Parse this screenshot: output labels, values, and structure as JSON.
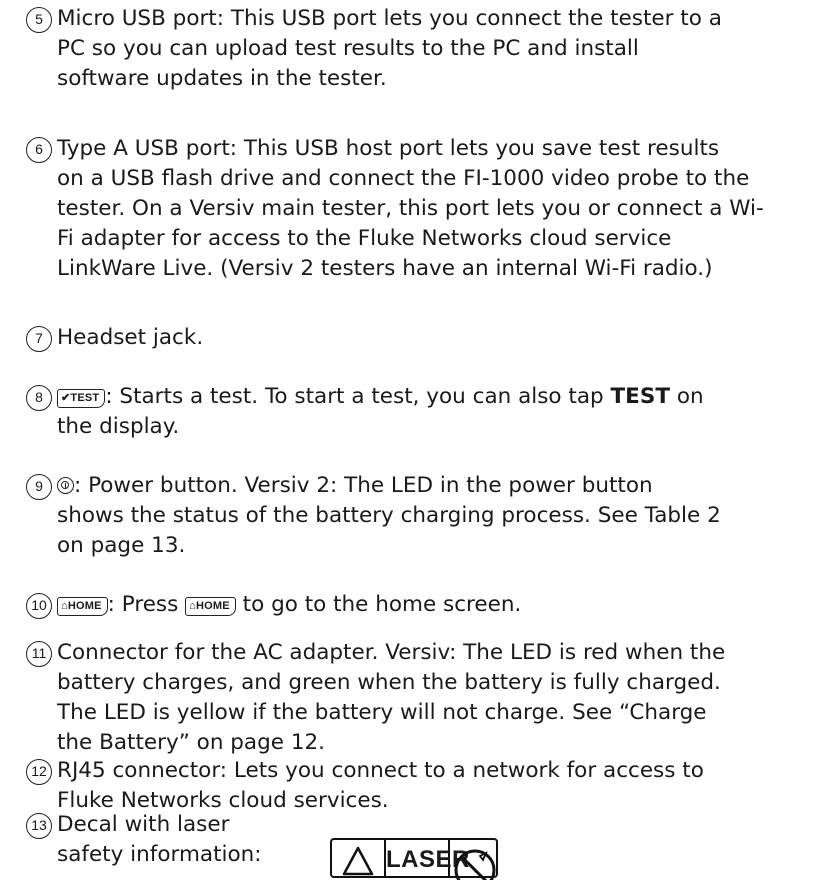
{
  "items": [
    {
      "num": "5",
      "lines": [
        "Micro USB port: This USB port lets you connect the tester to a",
        "PC so you can upload test results to the PC and install",
        "software updates in the tester."
      ]
    },
    {
      "num": "6",
      "lines": [
        "Type A USB port: This USB host port lets you save test results",
        "on a USB flash drive and connect the FI-1000 video probe to the",
        "tester. On a Versiv main tester, this port lets you or connect a Wi-",
        "Fi adapter for access to the Fluke Networks cloud service",
        "LinkWare Live. (Versiv 2 testers have an internal Wi-Fi radio.)"
      ]
    },
    {
      "num": "7",
      "lines": [
        "Headset jack."
      ]
    },
    {
      "num": "8",
      "key": "✔TEST",
      "a": ": Starts a test. To start a test, you can also tap ",
      "bold": "TEST",
      "b": " on",
      "line2": "the display."
    },
    {
      "num": "9",
      "a": ": Power button. Versiv 2: The LED in the power button",
      "lines": [
        "shows the status of the battery charging process. See Table 2",
        "on page 13."
      ]
    },
    {
      "num": "10",
      "key": "⌂HOME",
      "a": ": Press ",
      "b": " to go to the home screen."
    },
    {
      "num": "11",
      "lines": [
        "Connector for the AC adapter. Versiv: The LED is red when the",
        "battery charges, and green when the battery is fully charged.",
        "The LED is yellow if the battery will not charge. See “Charge",
        "the Battery” on page 12."
      ]
    },
    {
      "num": "12",
      "lines": [
        "RJ45 connector: Lets you connect to a network for access to",
        "Fluke Networks cloud services."
      ]
    },
    {
      "num": "13",
      "lines": [
        "Decal with laser",
        "safety information:"
      ]
    }
  ],
  "decal": {
    "laser_label": "LASER"
  }
}
